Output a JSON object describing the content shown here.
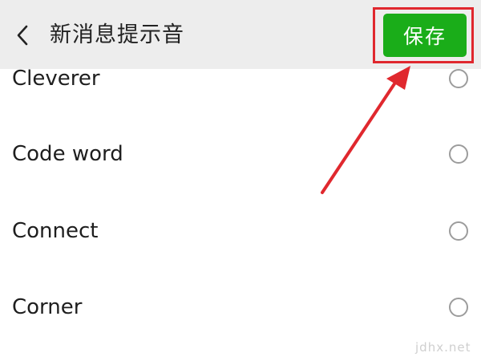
{
  "header": {
    "title": "新消息提示音",
    "back_icon": "chevron-left-icon",
    "save_label": "保存"
  },
  "sounds": [
    {
      "label": "Cleverer",
      "selected": false
    },
    {
      "label": "Code word",
      "selected": false
    },
    {
      "label": "Connect",
      "selected": false
    },
    {
      "label": "Corner",
      "selected": false
    }
  ],
  "annotation": {
    "highlight_color": "#e0282e",
    "arrow_color": "#e0282e"
  },
  "colors": {
    "header_bg": "#ededed",
    "save_button": "#1aad19"
  },
  "watermark": "jdhx.net"
}
